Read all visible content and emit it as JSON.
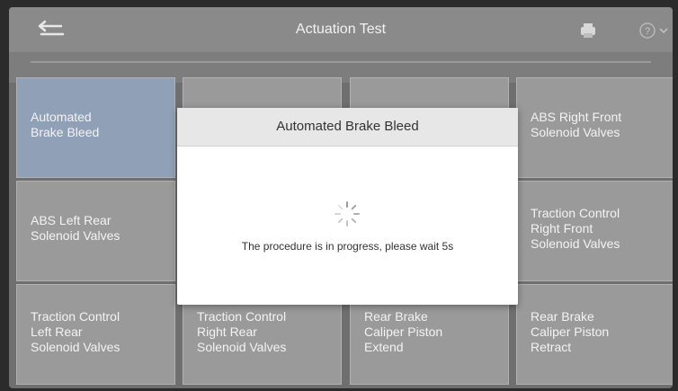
{
  "header": {
    "title": "Actuation Test"
  },
  "tiles": [
    {
      "label": "Automated\nBrake Bleed",
      "selected": true
    },
    {
      "label": "",
      "selected": false
    },
    {
      "label": "",
      "selected": false
    },
    {
      "label": "ABS Right Front\nSolenoid Valves",
      "selected": false
    },
    {
      "label": "ABS Left Rear\nSolenoid Valves",
      "selected": false
    },
    {
      "label": "",
      "selected": false
    },
    {
      "label": "",
      "selected": false
    },
    {
      "label": "Traction Control\nRight Front\nSolenoid Valves",
      "selected": false
    },
    {
      "label": "Traction Control\nLeft Rear\nSolenoid Valves",
      "selected": false
    },
    {
      "label": "Traction Control\nRight Rear\nSolenoid Valves",
      "selected": false
    },
    {
      "label": "Rear Brake\nCaliper Piston\nExtend",
      "selected": false
    },
    {
      "label": "Rear Brake\nCaliper Piston\nRetract",
      "selected": false
    }
  ],
  "dialog": {
    "title": "Automated Brake Bleed",
    "message": "The procedure is in progress, please wait 5s"
  },
  "icons": {
    "back": "back-arrow-icon",
    "print": "printer-icon",
    "help": "help-icon"
  },
  "colors": {
    "selected_tile": "#90a0b6",
    "tile": "#9a9a9a",
    "topbar": "#8a8a8a"
  }
}
